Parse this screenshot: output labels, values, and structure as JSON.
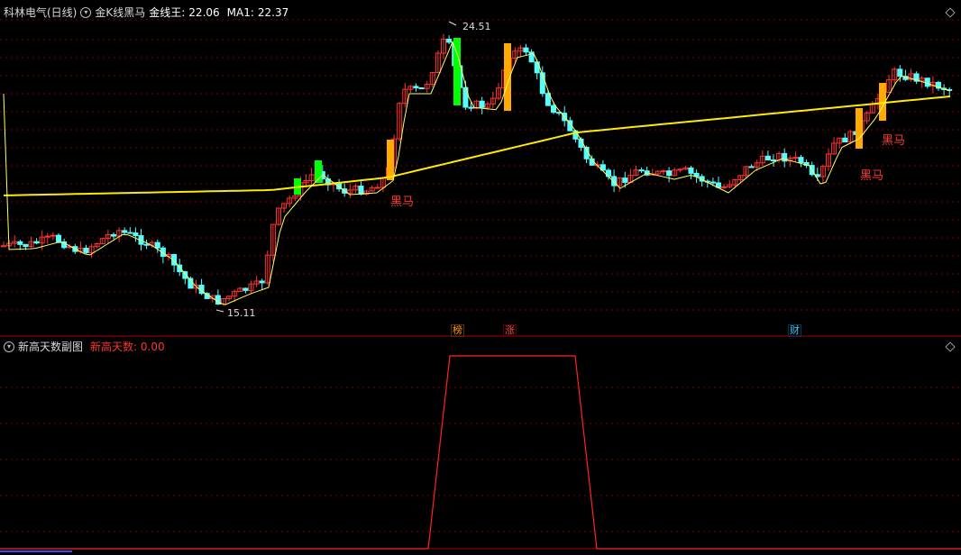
{
  "main_panel": {
    "stock_name": "科林电气(日线)",
    "indicator_name": "金K线黑马",
    "metrics": [
      {
        "label": "金线王:",
        "value": "22.06",
        "color": "#ffffff"
      },
      {
        "label": "MA1:",
        "value": "22.37",
        "color": "#ffffff"
      }
    ],
    "high_label": "24.51",
    "low_label": "15.11",
    "signal_labels": [
      "黑马",
      "黑马",
      "黑马"
    ],
    "event_badges": [
      {
        "text": "榜",
        "color": "#ff9900"
      },
      {
        "text": "涨",
        "color": "#ff4444"
      },
      {
        "text": "财",
        "color": "#33ccff"
      }
    ]
  },
  "sub_panel": {
    "indicator_name": "新高天数副图",
    "value_label": "新高天数: 0.00",
    "value_color": "#ff3333"
  },
  "colors": {
    "up": "#ff3333",
    "down": "#54ffff",
    "gold_line": "#ffea00",
    "ma1_line": "#ffff66",
    "signal_gold": "#ffaa00",
    "signal_green": "#00ff00",
    "grid": "#800000",
    "signal_text": "#ff3333"
  }
}
